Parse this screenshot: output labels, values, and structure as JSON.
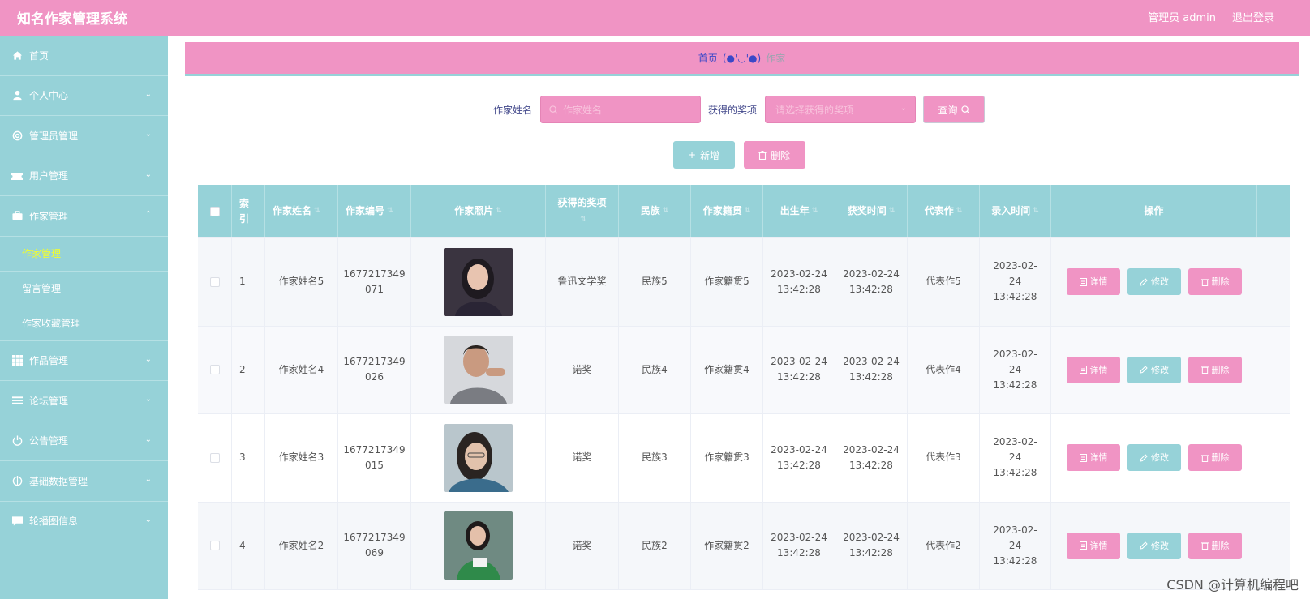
{
  "app": {
    "title": "知名作家管理系统",
    "user_label": "管理员 admin",
    "logout_label": "退出登录"
  },
  "sidebar": {
    "items": [
      {
        "label": "首页",
        "icon": "home-icon",
        "expanded": null
      },
      {
        "label": "个人中心",
        "icon": "user-icon",
        "expanded": false
      },
      {
        "label": "管理员管理",
        "icon": "lifebuoy-icon",
        "expanded": false
      },
      {
        "label": "用户管理",
        "icon": "ticket-icon",
        "expanded": false
      },
      {
        "label": "作家管理",
        "icon": "briefcase-icon",
        "expanded": true
      },
      {
        "label": "作品管理",
        "icon": "grid-icon",
        "expanded": false
      },
      {
        "label": "论坛管理",
        "icon": "list-icon",
        "expanded": false
      },
      {
        "label": "公告管理",
        "icon": "power-icon",
        "expanded": false
      },
      {
        "label": "基础数据管理",
        "icon": "crosshair-icon",
        "expanded": false
      },
      {
        "label": "轮播图信息",
        "icon": "chat-icon",
        "expanded": false
      }
    ],
    "sub_items": [
      "作家管理",
      "留言管理",
      "作家收藏管理"
    ],
    "active_sub": "作家管理"
  },
  "breadcrumb": {
    "home": "首页",
    "separator": "(●'◡'●)",
    "current": "作家"
  },
  "search": {
    "name_label": "作家姓名",
    "name_placeholder": "作家姓名",
    "award_label": "获得的奖项",
    "award_placeholder": "请选择获得的奖项",
    "query_label": "查询"
  },
  "actions": {
    "add_label": "新增",
    "delete_label": "删除"
  },
  "table": {
    "headers": [
      "索引",
      "作家姓名",
      "作家编号",
      "作家照片",
      "获得的奖项",
      "民族",
      "作家籍贯",
      "出生年",
      "获奖时间",
      "代表作",
      "录入时间",
      "操作"
    ],
    "rows": [
      {
        "index": "1",
        "name": "作家姓名5",
        "code_l1": "1677217349",
        "code_l2": "071",
        "award": "鲁迅文学奖",
        "ethnic": "民族5",
        "origin": "作家籍贯5",
        "birth_d": "2023-02-24",
        "birth_t": "13:42:28",
        "award_d": "2023-02-24",
        "award_t": "13:42:28",
        "work": "代表作5",
        "entry_d": "2023-02-24",
        "entry_t": "13:42:28"
      },
      {
        "index": "2",
        "name": "作家姓名4",
        "code_l1": "1677217349",
        "code_l2": "026",
        "award": "诺奖",
        "ethnic": "民族4",
        "origin": "作家籍贯4",
        "birth_d": "2023-02-24",
        "birth_t": "13:42:28",
        "award_d": "2023-02-24",
        "award_t": "13:42:28",
        "work": "代表作4",
        "entry_d": "2023-02-24",
        "entry_t": "13:42:28"
      },
      {
        "index": "3",
        "name": "作家姓名3",
        "code_l1": "1677217349",
        "code_l2": "015",
        "award": "诺奖",
        "ethnic": "民族3",
        "origin": "作家籍贯3",
        "birth_d": "2023-02-24",
        "birth_t": "13:42:28",
        "award_d": "2023-02-24",
        "award_t": "13:42:28",
        "work": "代表作3",
        "entry_d": "2023-02-24",
        "entry_t": "13:42:28"
      },
      {
        "index": "4",
        "name": "作家姓名2",
        "code_l1": "1677217349",
        "code_l2": "069",
        "award": "诺奖",
        "ethnic": "民族2",
        "origin": "作家籍贯2",
        "birth_d": "2023-02-24",
        "birth_t": "13:42:28",
        "award_d": "2023-02-24",
        "award_t": "13:42:28",
        "work": "代表作2",
        "entry_d": "2023-02-24",
        "entry_t": "13:42:28"
      }
    ],
    "row_actions": {
      "detail": "详情",
      "edit": "修改",
      "delete": "删除"
    }
  },
  "watermark": "CSDN @计算机编程吧",
  "colors": {
    "pink": "#f094c4",
    "teal": "#96d2d8",
    "active_sub": "#f4ff2a"
  }
}
